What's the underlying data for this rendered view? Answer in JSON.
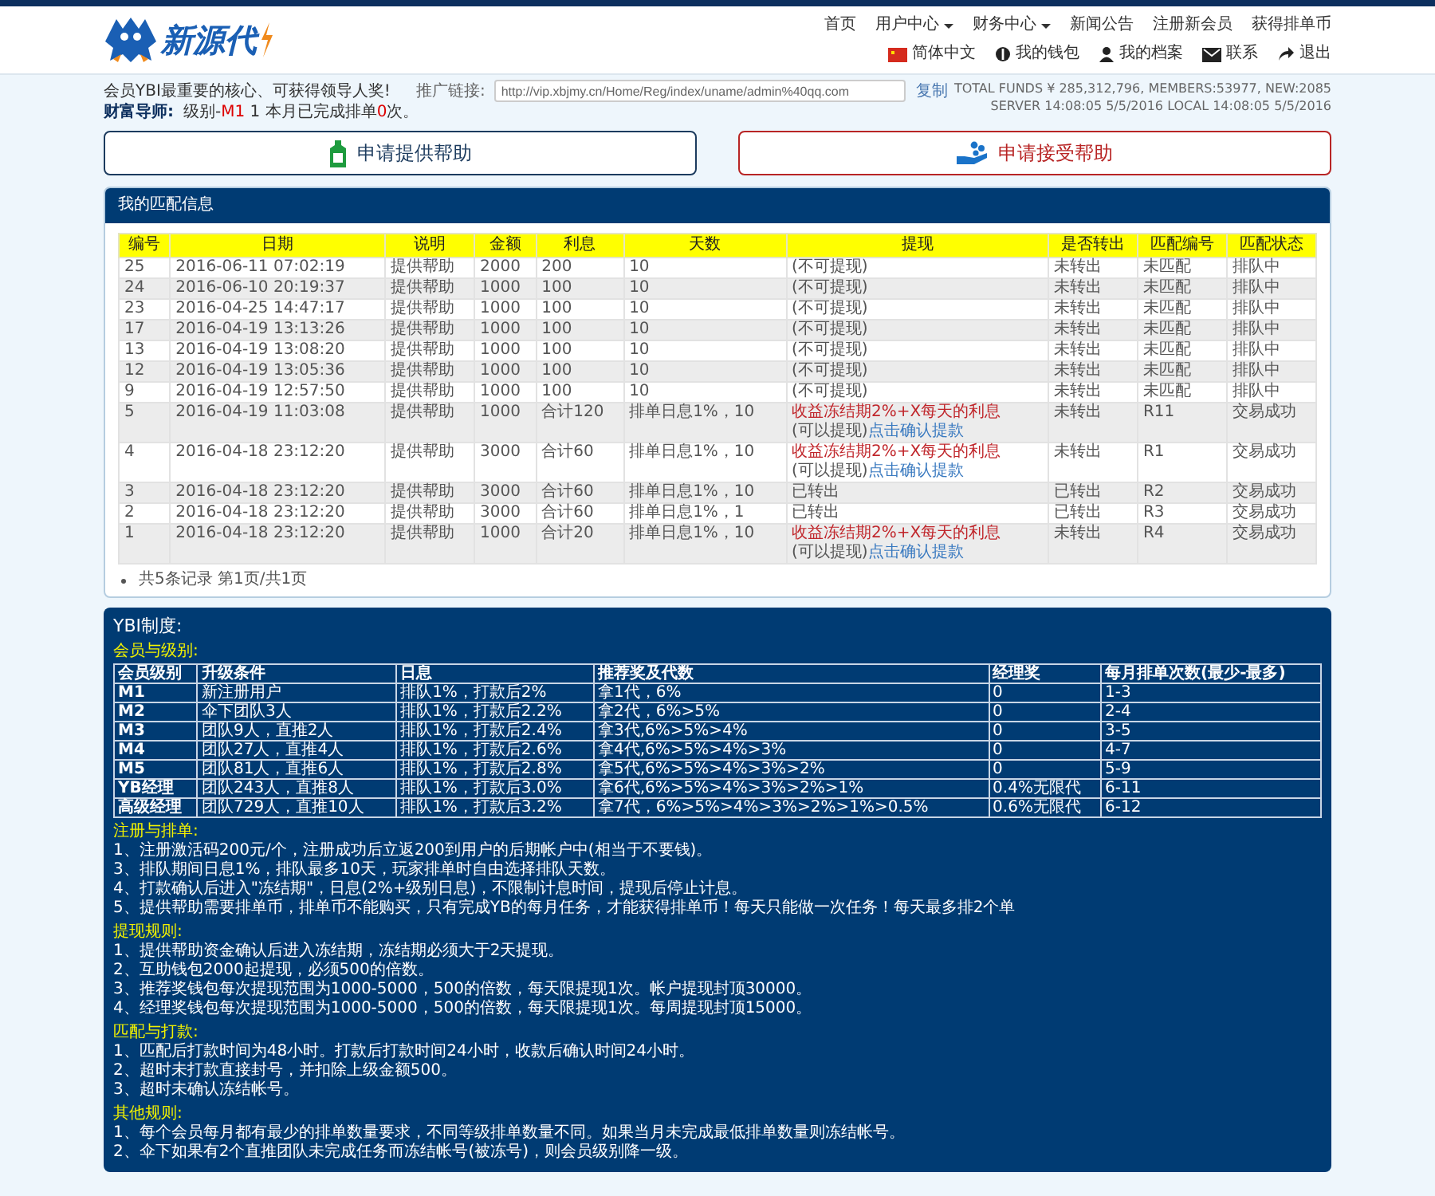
{
  "logo": {
    "text": "新源代"
  },
  "nav": [
    {
      "label": "首页",
      "dropdown": false
    },
    {
      "label": "用户中心",
      "dropdown": true
    },
    {
      "label": "财务中心",
      "dropdown": true
    },
    {
      "label": "新闻公告",
      "dropdown": false
    },
    {
      "label": "注册新会员",
      "dropdown": false
    },
    {
      "label": "获得排单币",
      "dropdown": false
    }
  ],
  "user_menu": [
    {
      "label": "简体中文",
      "kind": "flag"
    },
    {
      "label": "我的钱包",
      "kind": "dollar"
    },
    {
      "label": "我的档案",
      "kind": "person"
    },
    {
      "label": "联系",
      "kind": "mail"
    },
    {
      "label": "退出",
      "kind": "logout"
    }
  ],
  "info": {
    "slogan": "会员YBI最重要的核心、可获得领导人奖!",
    "promo_label": "推广链接:",
    "promo_link": "http://vip.xbjmy.cn/Home/Reg/index/uname/admin%40qq.com",
    "copy": "复制",
    "mentor_label": "财富导师:",
    "mentor_parts": [
      {
        "text": "级别-",
        "highlight": false
      },
      {
        "text": "M1",
        "highlight": true
      },
      {
        "text": " 1 本月已完成排单",
        "highlight": false
      },
      {
        "text": "0",
        "highlight": true
      },
      {
        "text": "次。",
        "highlight": false
      }
    ],
    "stats": [
      "TOTAL FUNDS ¥ 285,312,796, MEMBERS:53977, NEW:2085",
      "SERVER 14:08:05 5/5/2016 LOCAL 14:08:05 5/5/2016"
    ]
  },
  "actions": [
    {
      "label": "申请提供帮助",
      "kind": "provide"
    },
    {
      "label": "申请接受帮助",
      "kind": "receive"
    }
  ],
  "matches": {
    "title": "我的匹配信息",
    "columns": [
      "编号",
      "日期",
      "说明",
      "金额",
      "利息",
      "天数",
      "提现",
      "是否转出",
      "匹配编号",
      "匹配状态"
    ],
    "rows": [
      {
        "cells": [
          "25",
          "2016-06-11 07:02:19",
          "提供帮助",
          "2000",
          "200",
          "10"
        ],
        "withdraw": {
          "kind": "text",
          "text": "(不可提现)"
        },
        "tail": [
          "未转出",
          "未匹配",
          "排队中"
        ]
      },
      {
        "cells": [
          "24",
          "2016-06-10 20:19:37",
          "提供帮助",
          "1000",
          "100",
          "10"
        ],
        "withdraw": {
          "kind": "text",
          "text": "(不可提现)"
        },
        "tail": [
          "未转出",
          "未匹配",
          "排队中"
        ]
      },
      {
        "cells": [
          "23",
          "2016-04-25 14:47:17",
          "提供帮助",
          "1000",
          "100",
          "10"
        ],
        "withdraw": {
          "kind": "text",
          "text": "(不可提现)"
        },
        "tail": [
          "未转出",
          "未匹配",
          "排队中"
        ]
      },
      {
        "cells": [
          "17",
          "2016-04-19 13:13:26",
          "提供帮助",
          "1000",
          "100",
          "10"
        ],
        "withdraw": {
          "kind": "text",
          "text": "(不可提现)"
        },
        "tail": [
          "未转出",
          "未匹配",
          "排队中"
        ]
      },
      {
        "cells": [
          "13",
          "2016-04-19 13:08:20",
          "提供帮助",
          "1000",
          "100",
          "10"
        ],
        "withdraw": {
          "kind": "text",
          "text": "(不可提现)"
        },
        "tail": [
          "未转出",
          "未匹配",
          "排队中"
        ]
      },
      {
        "cells": [
          "12",
          "2016-04-19 13:05:36",
          "提供帮助",
          "1000",
          "100",
          "10"
        ],
        "withdraw": {
          "kind": "text",
          "text": "(不可提现)"
        },
        "tail": [
          "未转出",
          "未匹配",
          "排队中"
        ]
      },
      {
        "cells": [
          "9",
          "2016-04-19 12:57:50",
          "提供帮助",
          "1000",
          "100",
          "10"
        ],
        "withdraw": {
          "kind": "text",
          "text": "(不可提现)"
        },
        "tail": [
          "未转出",
          "未匹配",
          "排队中"
        ]
      },
      {
        "cells": [
          "5",
          "2016-04-19 11:03:08",
          "提供帮助",
          "1000",
          "合计120",
          "排单日息1%，10"
        ],
        "withdraw": {
          "kind": "action",
          "notice": "收益冻结期2%+X每天的利息",
          "prefix": "(可以提现)",
          "link": "点击确认提款"
        },
        "tail": [
          "未转出",
          "R11",
          "交易成功"
        ]
      },
      {
        "cells": [
          "4",
          "2016-04-18 23:12:20",
          "提供帮助",
          "3000",
          "合计60",
          "排单日息1%，10"
        ],
        "withdraw": {
          "kind": "action",
          "notice": "收益冻结期2%+X每天的利息",
          "prefix": "(可以提现)",
          "link": "点击确认提款"
        },
        "tail": [
          "未转出",
          "R1",
          "交易成功"
        ]
      },
      {
        "cells": [
          "3",
          "2016-04-18 23:12:20",
          "提供帮助",
          "3000",
          "合计60",
          "排单日息1%，10"
        ],
        "withdraw": {
          "kind": "text",
          "text": "已转出"
        },
        "tail": [
          "已转出",
          "R2",
          "交易成功"
        ]
      },
      {
        "cells": [
          "2",
          "2016-04-18 23:12:20",
          "提供帮助",
          "3000",
          "合计60",
          "排单日息1%，1"
        ],
        "withdraw": {
          "kind": "text",
          "text": "已转出"
        },
        "tail": [
          "已转出",
          "R3",
          "交易成功"
        ]
      },
      {
        "cells": [
          "1",
          "2016-04-18 23:12:20",
          "提供帮助",
          "1000",
          "合计20",
          "排单日息1%，10"
        ],
        "withdraw": {
          "kind": "action",
          "notice": "收益冻结期2%+X每天的利息",
          "prefix": "(可以提现)",
          "link": "点击确认提款"
        },
        "tail": [
          "未转出",
          "R4",
          "交易成功"
        ]
      }
    ],
    "footer": "共5条记录 第1页/共1页"
  },
  "ybi": {
    "title": "YBI制度:",
    "levels_heading": "会员与级别:",
    "level_columns": [
      "会员级别",
      "升级条件",
      "日息",
      "推荐奖及代数",
      "经理奖",
      "每月排单次数(最少-最多)"
    ],
    "levels": [
      [
        "M1",
        "新注册用户",
        "排队1%，打款后2%",
        "拿1代，6%",
        "0",
        "1-3"
      ],
      [
        "M2",
        "伞下团队3人",
        "排队1%，打款后2.2%",
        "拿2代，6%>5%",
        "0",
        "2-4"
      ],
      [
        "M3",
        "团队9人，直推2人",
        "排队1%，打款后2.4%",
        "拿3代,6%>5%>4%",
        "0",
        "3-5"
      ],
      [
        "M4",
        "团队27人，直推4人",
        "排队1%，打款后2.6%",
        "拿4代,6%>5%>4%>3%",
        "0",
        "4-7"
      ],
      [
        "M5",
        "团队81人，直推6人",
        "排队1%，打款后2.8%",
        "拿5代,6%>5%>4%>3%>2%",
        "0",
        "5-9"
      ],
      [
        "YB经理",
        "团队243人，直推8人",
        "排队1%，打款后3.0%",
        "拿6代,6%>5%>4%>3%>2%>1%",
        "0.4%无限代",
        "6-11"
      ],
      [
        "高级经理",
        "团队729人，直推10人",
        "排队1%，打款后3.2%",
        "拿7代，6%>5%>4%>3%>2%>1%>0.5%",
        "0.6%无限代",
        "6-12"
      ]
    ],
    "sections": [
      {
        "heading": "注册与排单:",
        "lines": [
          "1、注册激活码200元/个，注册成功后立返200到用户的后期帐户中(相当于不要钱)。",
          "3、排队期间日息1%，排队最多10天，玩家排单时自由选择排队天数。",
          "4、打款确认后进入\"冻结期\"，日息(2%+级别日息)，不限制计息时间，提现后停止计息。",
          "5、提供帮助需要排单币，排单币不能购买，只有完成YB的每月任务，才能获得排单币！每天只能做一次任务！每天最多排2个单"
        ]
      },
      {
        "heading": "提现规则:",
        "lines": [
          "1、提供帮助资金确认后进入冻结期，冻结期必须大于2天提现。",
          "2、互助钱包2000起提现，必须500的倍数。",
          "3、推荐奖钱包每次提现范围为1000-5000，500的倍数，每天限提现1次。帐户提现封顶30000。",
          "4、经理奖钱包每次提现范围为1000-5000，500的倍数，每天限提现1次。每周提现封顶15000。"
        ]
      },
      {
        "heading": "匹配与打款:",
        "lines": [
          "1、匹配后打款时间为48小时。打款后打款时间24小时，收款后确认时间24小时。",
          "2、超时未打款直接封号，并扣除上级金额500。",
          "3、超时未确认冻结帐号。"
        ]
      },
      {
        "heading": "其他规则:",
        "lines": [
          "1、每个会员每月都有最少的排单数量要求，不同等级排单数量不同。如果当月未完成最低排单数量则冻结帐号。",
          "2、伞下如果有2个直推团队未完成任务而冻结帐号(被冻号)，则会员级别降一级。"
        ]
      }
    ]
  }
}
